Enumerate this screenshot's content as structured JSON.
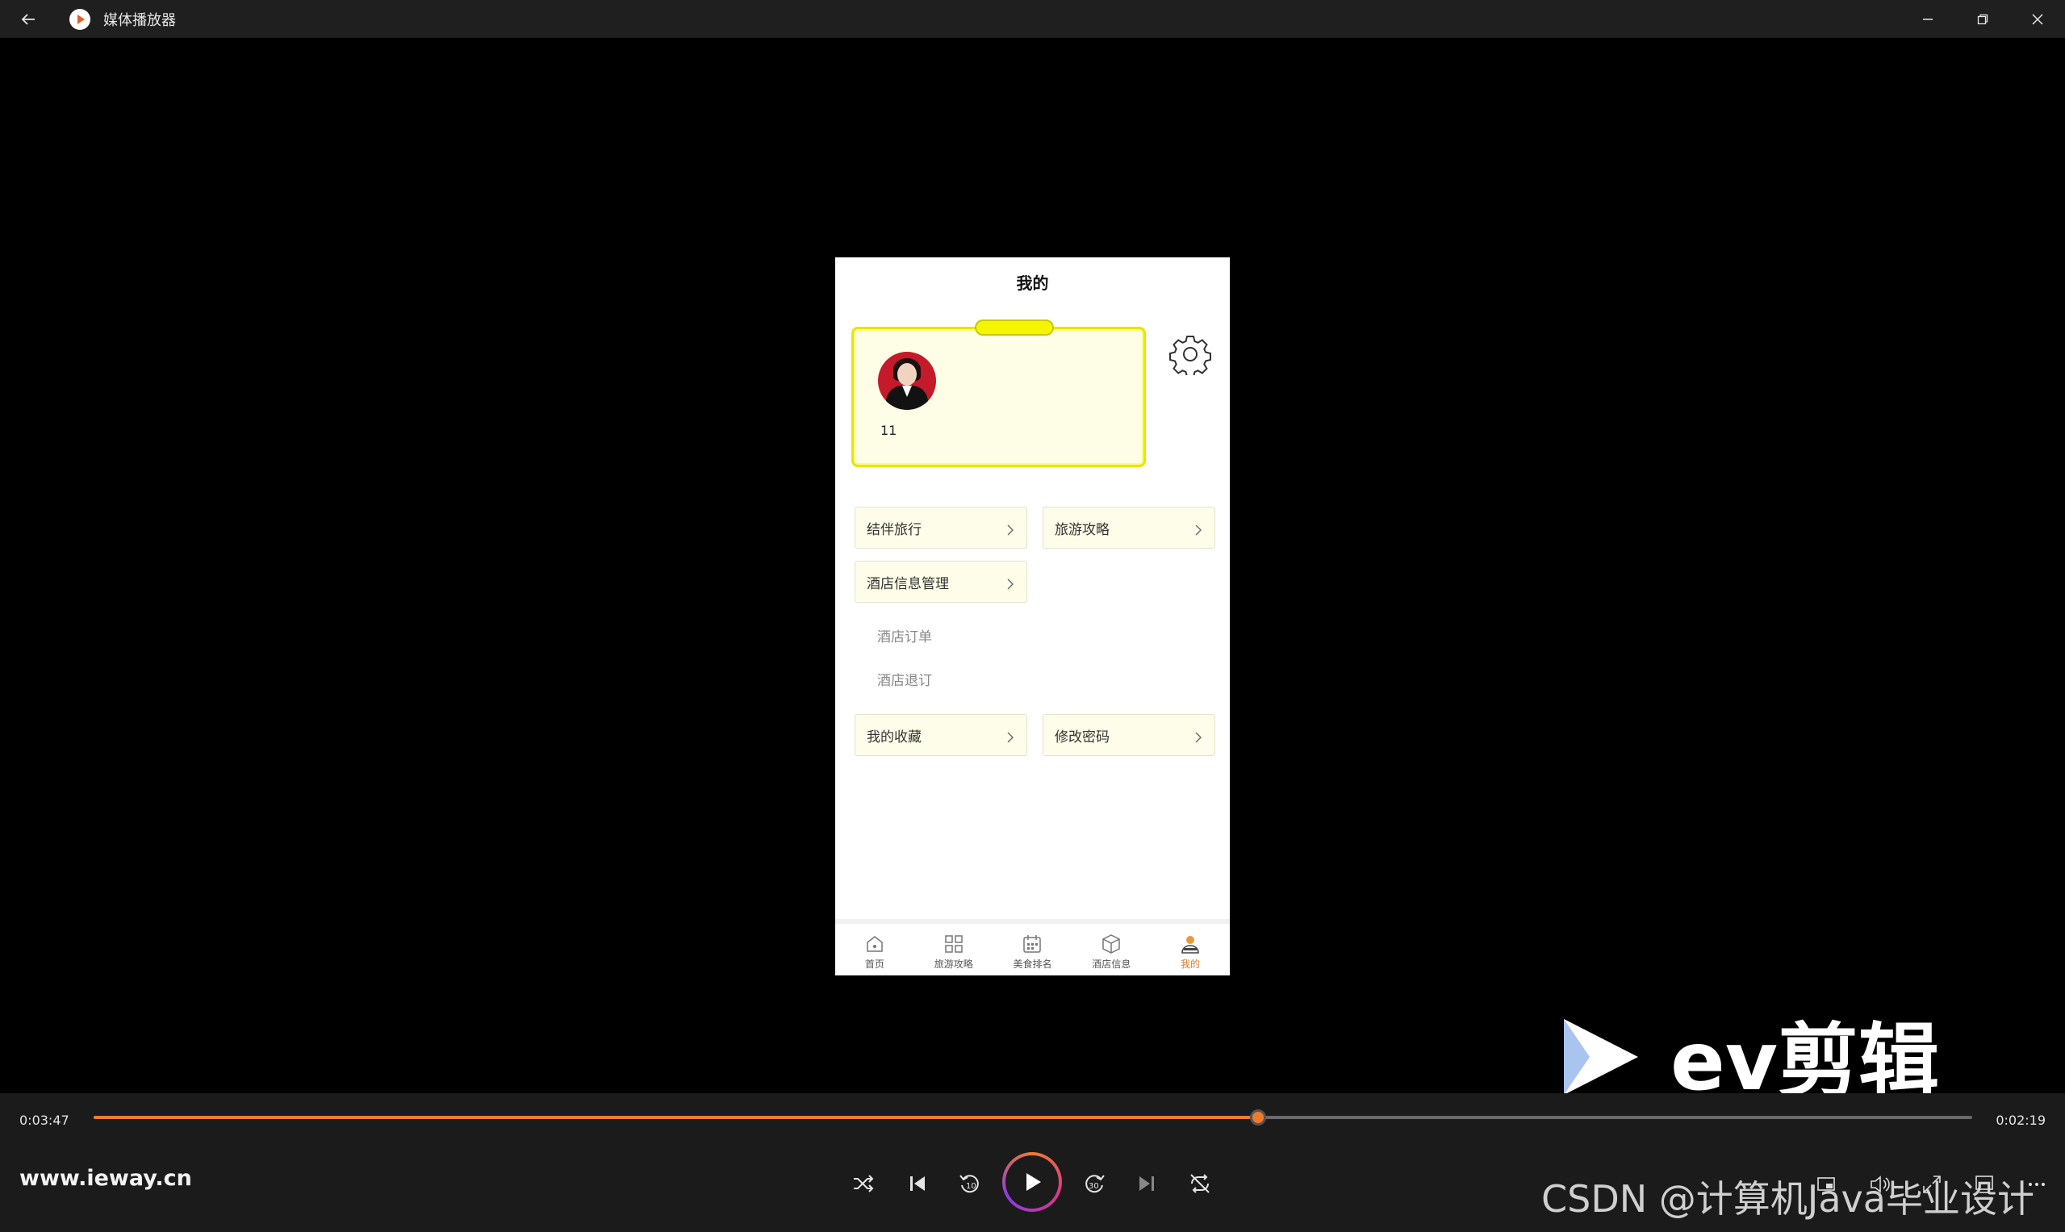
{
  "window": {
    "title": "媒体播放器"
  },
  "phone": {
    "header_title": "我的",
    "username": "11",
    "menu": {
      "travel_partner": "结伴旅行",
      "travel_guide": "旅游攻略",
      "hotel_info_manage": "酒店信息管理",
      "hotel_order": "酒店订单",
      "hotel_cancel": "酒店退订",
      "my_favorites": "我的收藏",
      "change_password": "修改密码"
    },
    "tabs": [
      {
        "label": "首页",
        "icon": "home-icon"
      },
      {
        "label": "旅游攻略",
        "icon": "grid-icon"
      },
      {
        "label": "美食排名",
        "icon": "calendar-icon"
      },
      {
        "label": "酒店信息",
        "icon": "box-icon"
      },
      {
        "label": "我的",
        "icon": "user-icon",
        "active": true
      }
    ]
  },
  "watermark": {
    "logo_text": "ev剪辑"
  },
  "player": {
    "current_time": "0:03:47",
    "remaining_time": "0:02:19",
    "progress": 0.62,
    "site": "www.ieway.cn",
    "overlay_text": "CSDN @计算机Java毕业设计",
    "skip_back_seconds": "10",
    "skip_forward_seconds": "30",
    "accent_color": "#f07b2f"
  }
}
